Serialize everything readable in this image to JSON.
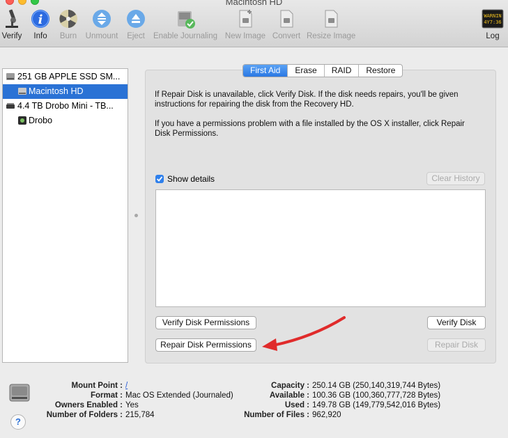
{
  "window": {
    "title": "Macintosh HD"
  },
  "toolbar": {
    "verify": "Verify",
    "info": "Info",
    "burn": "Burn",
    "unmount": "Unmount",
    "eject": "Eject",
    "enable_journaling": "Enable Journaling",
    "new_image": "New Image",
    "convert": "Convert",
    "resize_image": "Resize Image",
    "log": "Log",
    "log_icon_text": [
      "WARNIN",
      "4Y7:36"
    ]
  },
  "sidebar": {
    "items": [
      {
        "label": "251 GB APPLE SSD SM...",
        "icon": "internal-drive-icon",
        "selected": false
      },
      {
        "label": "Macintosh HD",
        "icon": "volume-icon",
        "selected": true
      },
      {
        "label": "4.4 TB Drobo Mini - TB...",
        "icon": "external-drive-icon",
        "selected": false
      },
      {
        "label": "Drobo",
        "icon": "volume-icon",
        "selected": false
      }
    ]
  },
  "tabs": [
    "First Aid",
    "Erase",
    "RAID",
    "Restore"
  ],
  "active_tab": "First Aid",
  "first_aid": {
    "info_1": "If Repair Disk is unavailable, click Verify Disk. If the disk needs repairs, you'll be given instructions for repairing the disk from the Recovery HD.",
    "info_2": "If you have a permissions problem with a file installed by the OS X installer, click Repair Disk Permissions.",
    "show_details": "Show details",
    "show_details_checked": true,
    "clear_history": "Clear History",
    "verify_permissions": "Verify Disk Permissions",
    "repair_permissions": "Repair Disk Permissions",
    "verify_disk": "Verify Disk",
    "repair_disk": "Repair Disk"
  },
  "disk_info": {
    "mount_point_label": "Mount Point :",
    "mount_point": "/",
    "format_label": "Format :",
    "format": "Mac OS Extended (Journaled)",
    "owners_label": "Owners Enabled :",
    "owners": "Yes",
    "folders_label": "Number of Folders :",
    "folders": "215,784",
    "capacity_label": "Capacity :",
    "capacity": "250.14 GB (250,140,319,744 Bytes)",
    "available_label": "Available :",
    "available": "100.36 GB (100,360,777,728 Bytes)",
    "used_label": "Used :",
    "used": "149.78 GB (149,779,542,016 Bytes)",
    "files_label": "Number of Files :",
    "files": "962,920"
  },
  "colors": {
    "accent": "#2a72d5",
    "arrow": "#e02b2b"
  }
}
